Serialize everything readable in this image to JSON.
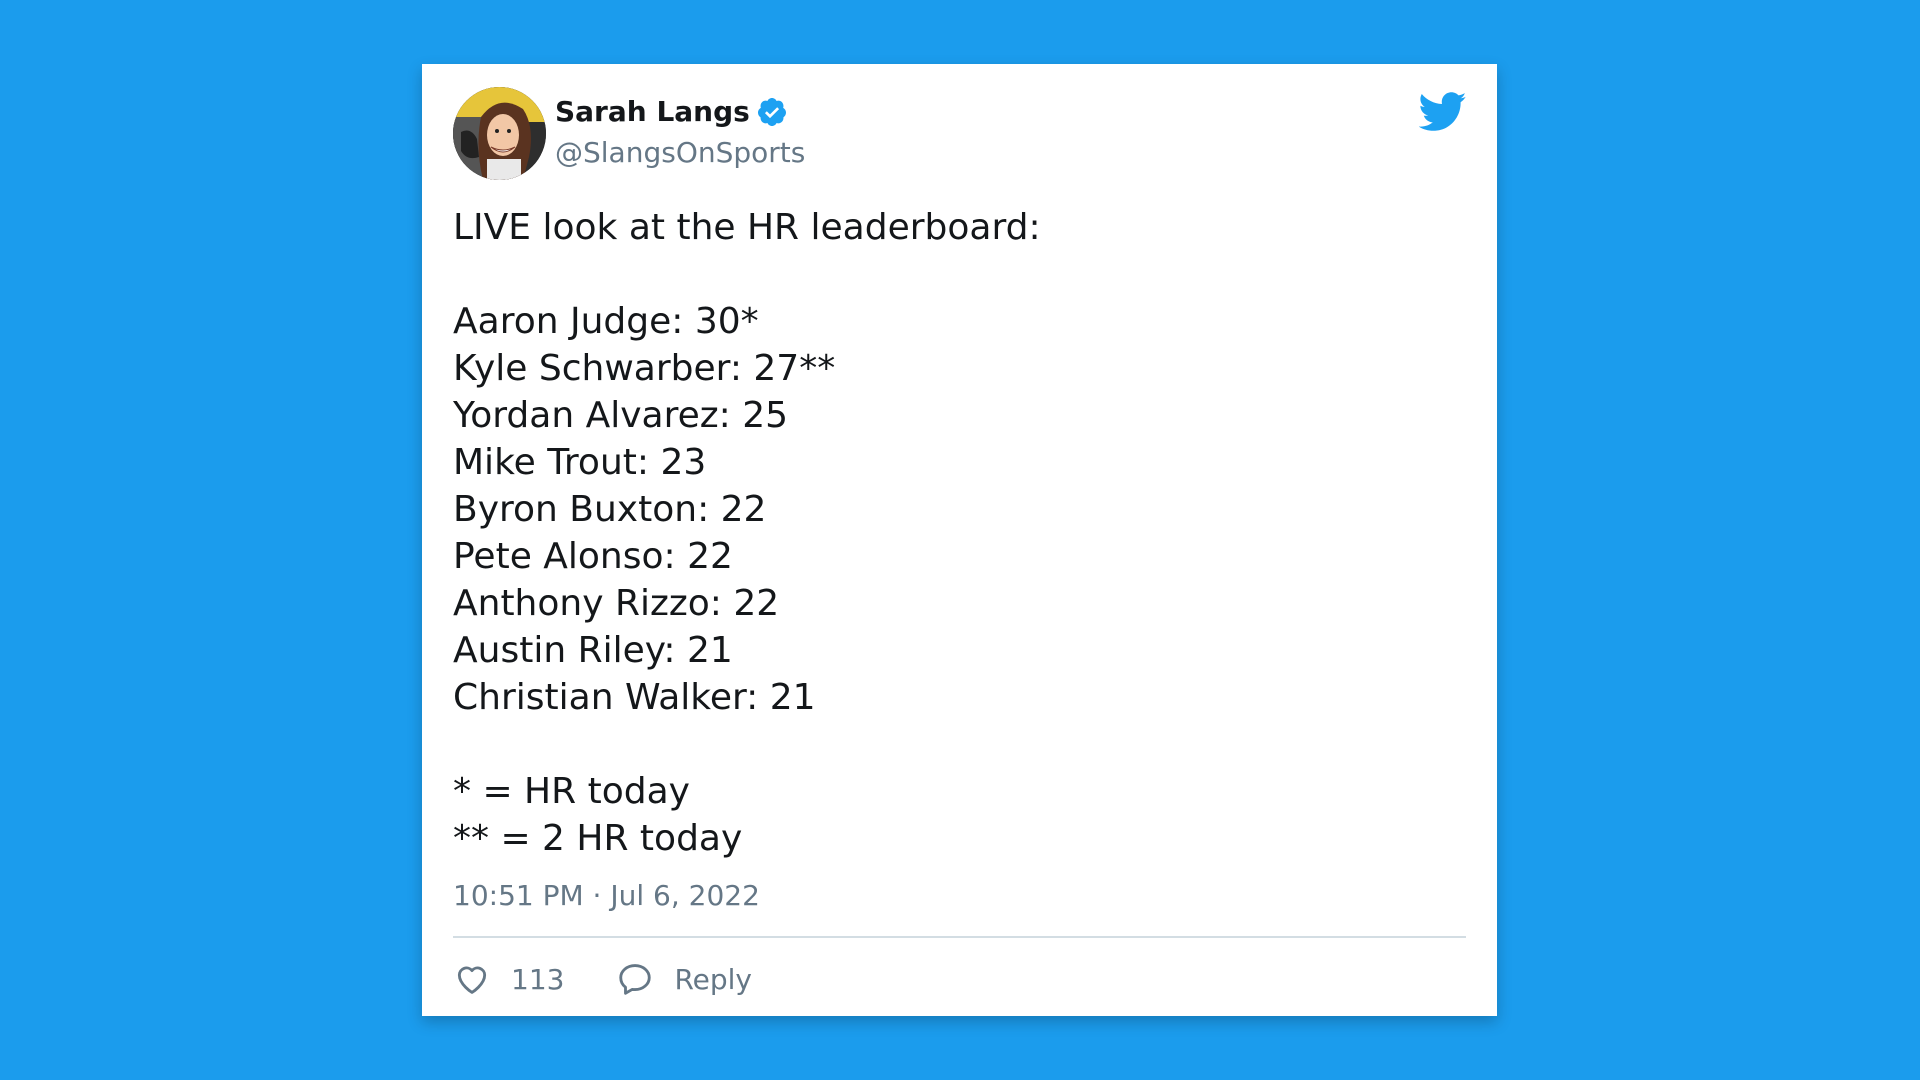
{
  "tweet": {
    "author": {
      "name": "Sarah Langs",
      "handle": "@SlangsOnSports",
      "verified": true,
      "avatar_icon": "avatar-cartoon"
    },
    "brand_icon": "twitter-bird-icon",
    "text": {
      "intro": "LIVE look at the HR leaderboard:",
      "leaders": [
        "Aaron Judge: 30*",
        "Kyle Schwarber: 27**",
        "Yordan Alvarez: 25",
        "Mike Trout: 23",
        "Byron Buxton: 22",
        "Pete Alonso: 22",
        "Anthony Rizzo: 22",
        "Austin Riley: 21",
        "Christian Walker: 21"
      ],
      "legend": [
        "* = HR today",
        "** = 2 HR today"
      ]
    },
    "timestamp": "10:51 PM · Jul 6, 2022",
    "actions": {
      "likes": "113",
      "reply_label": "Reply"
    }
  },
  "colors": {
    "background": "#1b9ced",
    "accent": "#1da1f2",
    "text_primary": "#14171a",
    "text_secondary": "#657786"
  }
}
